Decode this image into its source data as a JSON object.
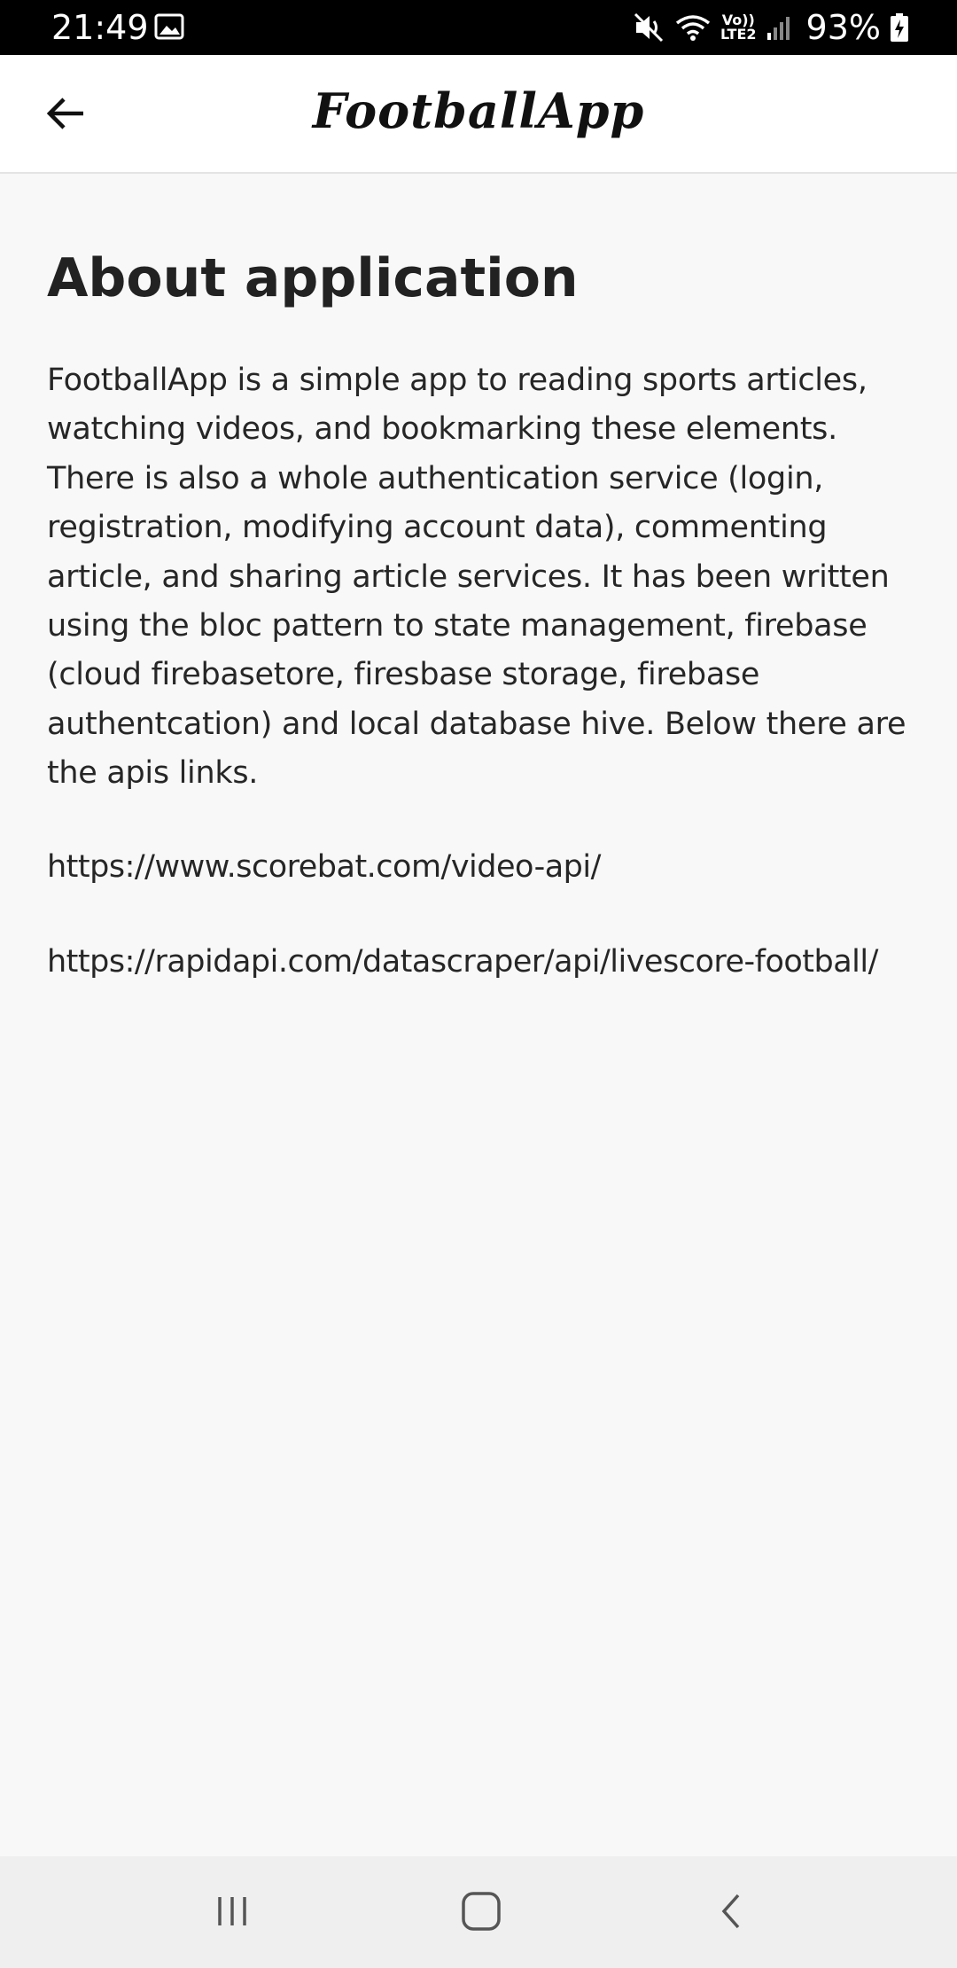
{
  "status_bar": {
    "time": "21:49",
    "battery": "93%",
    "icons": [
      "image-icon",
      "mute-icon",
      "wifi-icon",
      "volte-icon",
      "signal-icon",
      "battery-icon"
    ],
    "volte_label_top": "Vo))",
    "volte_label_bottom": "LTE2"
  },
  "app_bar": {
    "title": "FootballApp",
    "back_icon": "arrow-back-icon"
  },
  "main": {
    "heading": "About application",
    "description": "FootballApp is a simple app to reading sports articles, watching videos, and bookmarking these elements. There is also a whole authentication service (login, registration, modifying account data), commenting article, and sharing article services. It has been written using the bloc pattern to state management, firebase (cloud firebasetore, firesbase storage, firebase authentcation) and local database hive. Below there are the apis links.",
    "links": [
      "https://www.scorebat.com/video-api/",
      "https://rapidapi.com/datascraper/api/livescore-football/"
    ]
  },
  "nav_bar": {
    "icons": [
      "recent-apps-icon",
      "home-icon",
      "back-icon"
    ]
  },
  "colors": {
    "status_bar": "#000000",
    "app_bar": "#ffffff",
    "background": "#f8f8f8",
    "nav_bar": "#efefef",
    "text": "#262626"
  }
}
